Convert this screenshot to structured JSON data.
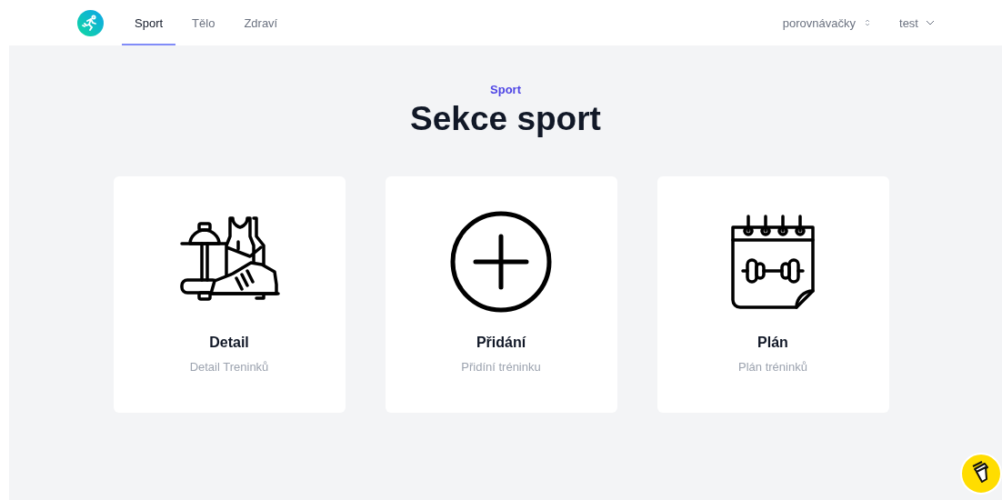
{
  "nav": {
    "tabs": [
      {
        "label": "Sport",
        "selected": true
      },
      {
        "label": "Tělo",
        "selected": false
      },
      {
        "label": "Zdraví",
        "selected": false
      }
    ],
    "selector": {
      "label": "porovnávačky"
    },
    "user": {
      "label": "test"
    }
  },
  "header": {
    "eyebrow": "Sport",
    "title": "Sekce sport"
  },
  "cards": [
    {
      "kind": "gear",
      "title": "Detail",
      "subtitle": "Detail Treninků"
    },
    {
      "kind": "add",
      "title": "Přidání",
      "subtitle": "Přidíní tréninku"
    },
    {
      "kind": "calendar",
      "title": "Plán",
      "subtitle": "Plán tréninků"
    }
  ]
}
